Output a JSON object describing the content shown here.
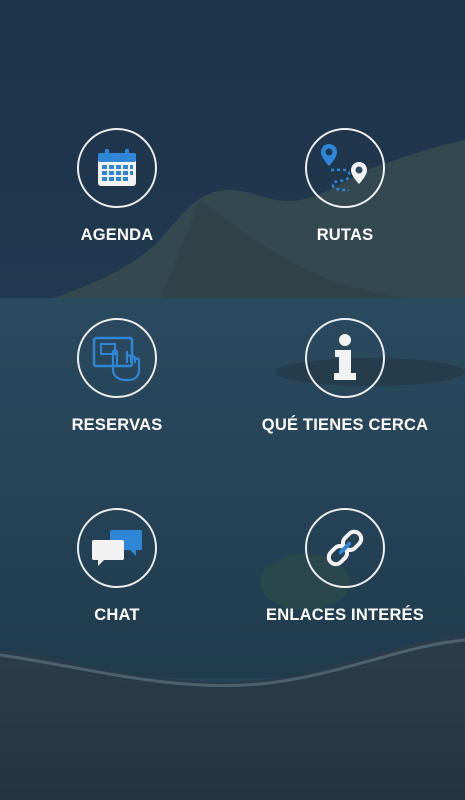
{
  "menu": {
    "agenda": {
      "label": "AGENDA",
      "icon": "calendar-icon"
    },
    "rutas": {
      "label": "RUTAS",
      "icon": "route-map-pin-icon"
    },
    "reservas": {
      "label": "RESERVAS",
      "icon": "touch-screen-hand-icon"
    },
    "cerca": {
      "label": "QUÉ TIENES CERCA",
      "icon": "info-icon"
    },
    "chat": {
      "label": "CHAT",
      "icon": "chat-bubbles-icon"
    },
    "enlaces": {
      "label": "ENLACES INTERÉS",
      "icon": "link-chain-icon"
    }
  },
  "colors": {
    "accent_blue": "#2f86d6",
    "overlay": "#1e3a52",
    "icon_white": "#f2f2f2"
  }
}
